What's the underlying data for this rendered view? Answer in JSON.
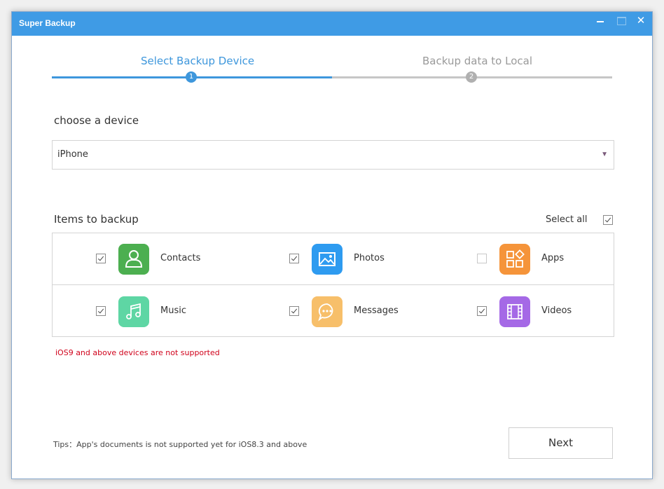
{
  "window": {
    "title": "Super Backup",
    "close_glyph": "✕"
  },
  "steps": [
    {
      "label": "Select Backup Device",
      "number": "1",
      "state": "active"
    },
    {
      "label": "Backup data to Local",
      "number": "2",
      "state": "inactive"
    }
  ],
  "progress": {
    "fraction": 0.5
  },
  "device": {
    "label": "choose a device",
    "selected": "iPhone",
    "arrow_glyph": "▼"
  },
  "items": {
    "label": "Items to backup",
    "select_all": {
      "label": "Select all",
      "checked": true
    },
    "list": [
      {
        "label": "Contacts",
        "checked": true,
        "icon": "contacts-icon",
        "color": "#4caf50"
      },
      {
        "label": "Photos",
        "checked": true,
        "icon": "photos-icon",
        "color": "#2e9bf0"
      },
      {
        "label": "Apps",
        "checked": false,
        "icon": "apps-icon",
        "color": "#f5943a"
      },
      {
        "label": "Music",
        "checked": true,
        "icon": "music-icon",
        "color": "#5ed6a4"
      },
      {
        "label": "Messages",
        "checked": true,
        "icon": "messages-icon",
        "color": "#f7bf6a"
      },
      {
        "label": "Videos",
        "checked": true,
        "icon": "videos-icon",
        "color": "#a569e6"
      }
    ]
  },
  "warning": "iOS9 and above devices are not supported",
  "tips": "Tips：App's documents is not supported yet for iOS8.3 and above",
  "next_button": "Next",
  "colors": {
    "accent": "#3e97dc",
    "titlebar": "#3f9be5",
    "warning": "#d0021b"
  }
}
